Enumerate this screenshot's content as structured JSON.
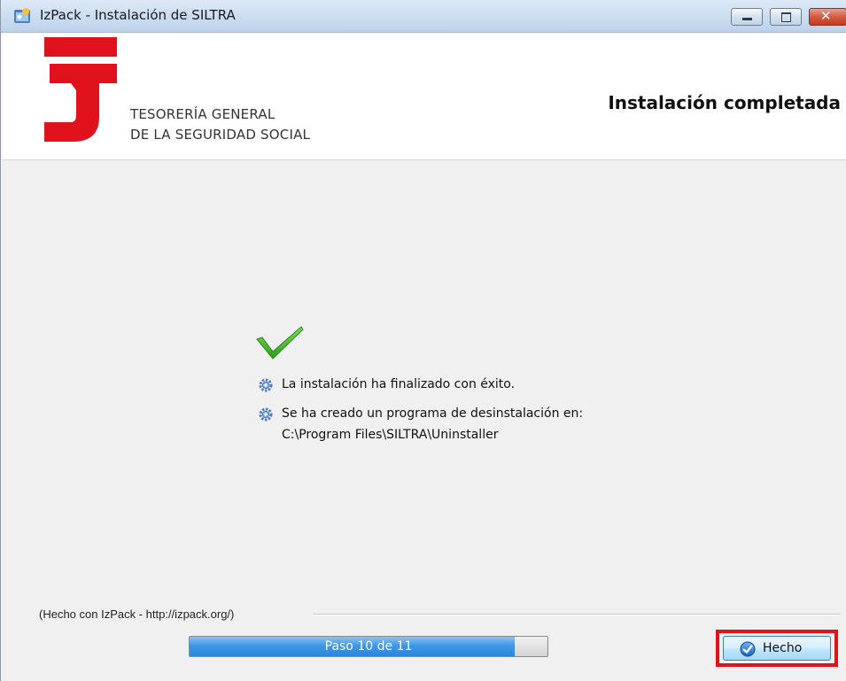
{
  "window": {
    "title": "IzPack - Instalación de  SILTRA",
    "controls": {
      "minimize_icon": "minimize-icon",
      "maximize_icon": "maximize-icon",
      "close_glyph": "✕"
    }
  },
  "header": {
    "org_line1": "TESORERÍA GENERAL",
    "org_line2": "DE LA SEGURIDAD SOCIAL",
    "title": "Instalación completada",
    "logo_color": "#e0131c"
  },
  "content": {
    "status_icon": "green-checkmark-icon",
    "messages": [
      {
        "icon": "gear-icon",
        "text": "La instalación ha finalizado con éxito."
      },
      {
        "icon": "gear-icon",
        "text": "Se ha creado un programa de desinstalación en:"
      }
    ],
    "uninstaller_path": "C:\\Program Files\\SILTRA\\Uninstaller"
  },
  "footer": {
    "made_with": "(Hecho con IzPack - http://izpack.org/)",
    "progress": {
      "label": "Paso 10 de 11",
      "current": 10,
      "total": 11,
      "fraction": 0.909
    },
    "done_button": {
      "label": "Hecho",
      "icon": "check-circle-icon"
    },
    "highlight_color": "#e0131c"
  }
}
